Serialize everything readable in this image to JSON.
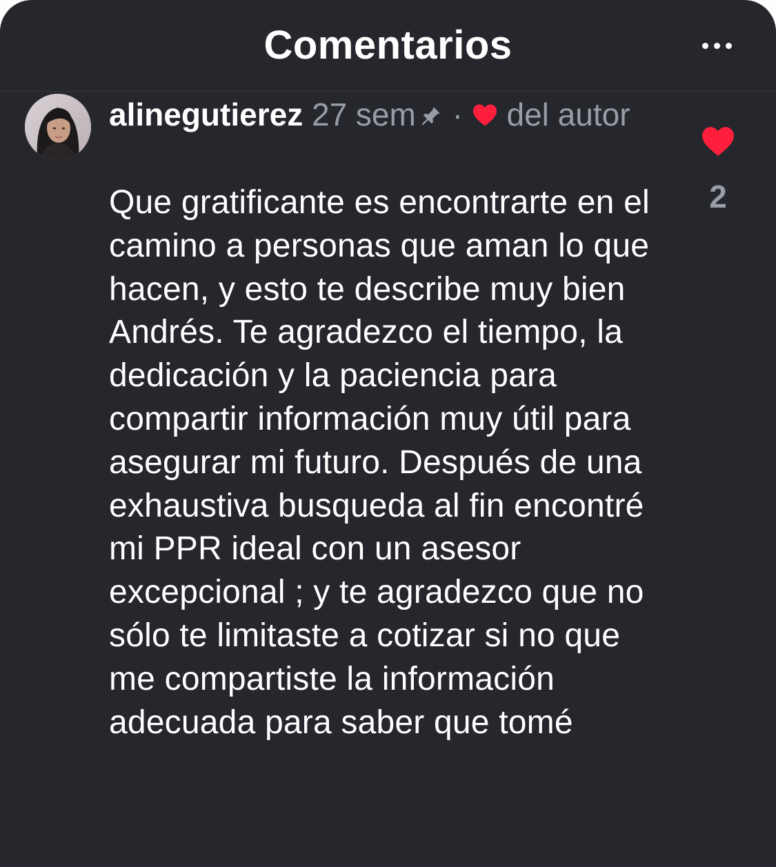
{
  "header": {
    "title": "Comentarios",
    "more_icon": "more-horizontal-icon"
  },
  "comment": {
    "username": "alinegutierez",
    "time": "27 sem",
    "separator": "·",
    "liked_by_author_label": "del autor",
    "pin_icon": "pin-icon",
    "author_heart_icon": "heart-icon",
    "text": "Que gratificante es encontrarte en el camino a personas que aman lo que hacen, y esto te describe muy bien Andrés. Te agradezco el tiempo, la dedicación y la paciencia para compartir información muy útil para asegurar mi futuro. Después de una exhaustiva busqueda al fin encontré mi PPR ideal con un asesor excepcional ; y te agradezco que no sólo te limitaste a cotizar si no que me compartiste la información adecuada para saber que tomé",
    "like_icon": "heart-icon",
    "like_count": "2"
  },
  "colors": {
    "background": "#25272c",
    "text": "#ffffff",
    "muted": "#9a9da6",
    "heart": "#ff1f3d"
  }
}
